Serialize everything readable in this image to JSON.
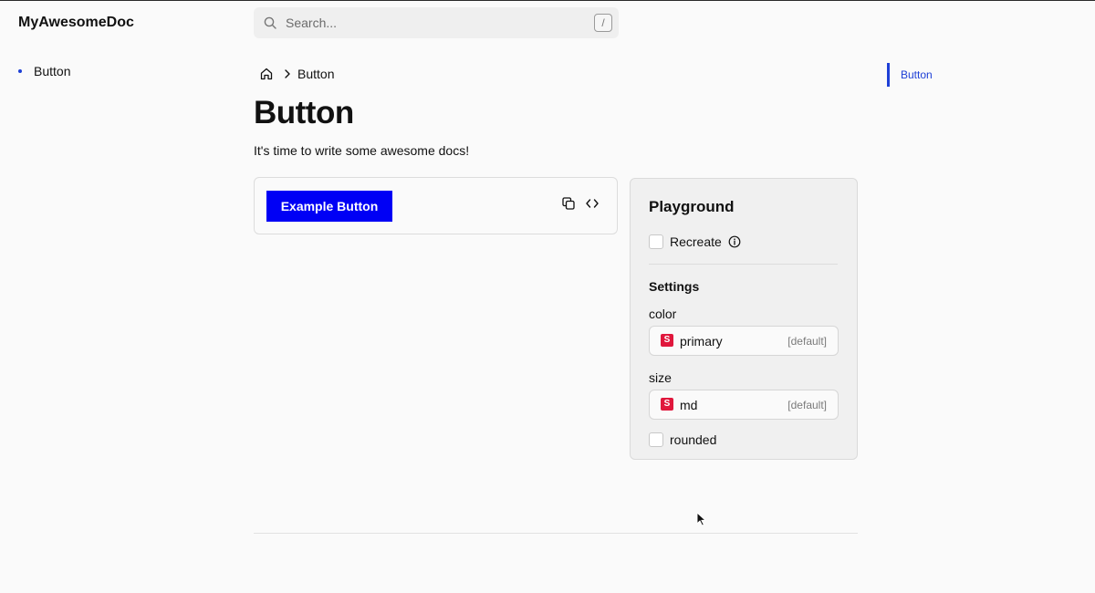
{
  "header": {
    "brand": "MyAwesomeDoc",
    "search": {
      "placeholder": "Search...",
      "shortcut": "/"
    }
  },
  "sidebar": {
    "items": [
      {
        "label": "Button"
      }
    ]
  },
  "breadcrumb": {
    "current": "Button"
  },
  "main": {
    "title": "Button",
    "description": "It's time to write some awesome docs!",
    "preview": {
      "button_label": "Example Button",
      "button_color": "#0000f5"
    }
  },
  "playground": {
    "title": "Playground",
    "recreate_label": "Recreate",
    "settings_heading": "Settings",
    "color": {
      "label": "color",
      "value": "primary",
      "badge": "[default]",
      "type_icon": "S"
    },
    "size": {
      "label": "size",
      "value": "md",
      "badge": "[default]",
      "type_icon": "S"
    },
    "rounded_label": "rounded"
  },
  "toc": {
    "items": [
      {
        "label": "Button"
      }
    ]
  },
  "colors": {
    "accent": "#1d3fd6",
    "type_icon": "#e0173c"
  }
}
